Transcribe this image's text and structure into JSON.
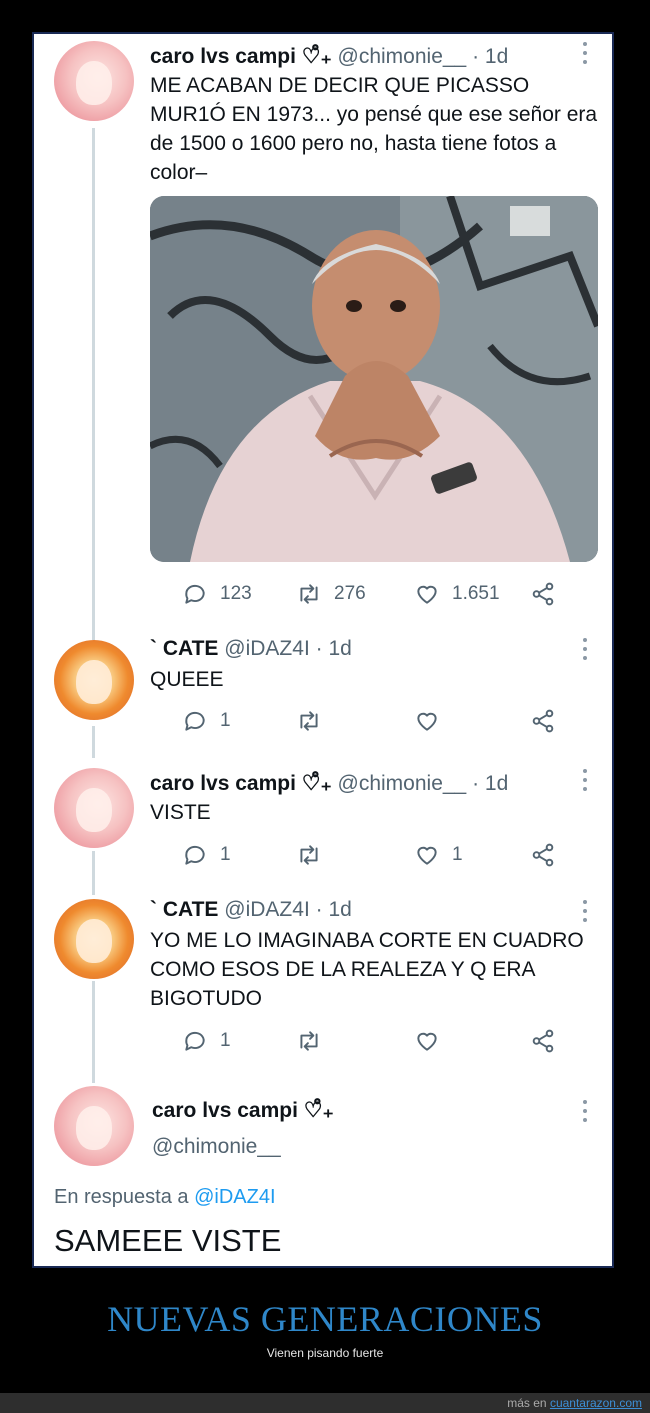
{
  "tweets": [
    {
      "name": "caro lvs campi ♡̊₊",
      "handle": "@chimonie__",
      "time": "· 1d",
      "text": "ME ACABAN DE DECIR QUE PICASSO MUR1Ó EN 1973... yo pensé que ese señor era de 1500 o 1600 pero no, hasta tiene fotos a color–",
      "replies": "123",
      "retweets": "276",
      "likes": "1.651"
    },
    {
      "name": "` CATE",
      "handle": "@iDAZ4I",
      "time": "· 1d",
      "text": "QUEEE",
      "replies": "1",
      "retweets": "",
      "likes": ""
    },
    {
      "name": "caro lvs campi ♡̊₊",
      "handle": "@chimonie__",
      "time": "· 1d",
      "text": "VISTE",
      "replies": "1",
      "retweets": "",
      "likes": "1"
    },
    {
      "name": "` CATE",
      "handle": "@iDAZ4I",
      "time": "· 1d",
      "text": "YO ME LO IMAGINABA CORTE EN CUADRO COMO ESOS DE LA REALEZA Y Q ERA BIGOTUDO",
      "replies": "1",
      "retweets": "",
      "likes": ""
    }
  ],
  "main_tweet": {
    "name": "caro lvs campi ♡̊₊",
    "handle": "@chimonie__",
    "reply_prefix": "En respuesta a",
    "reply_handle": "@iDAZ4I",
    "text": "SAMEEE VISTE"
  },
  "caption": {
    "title": "NUEVAS GENERACIONES",
    "subtitle": "Vienen pisando fuerte"
  },
  "footer": {
    "prefix": "más en",
    "site": "cuantarazon.com"
  },
  "icons": [
    "reply-icon",
    "retweet-icon",
    "like-icon",
    "share-icon",
    "more-icon"
  ],
  "colors": {
    "link": "#1d9bf0",
    "caption": "#2f87c9",
    "muted": "#536471"
  }
}
